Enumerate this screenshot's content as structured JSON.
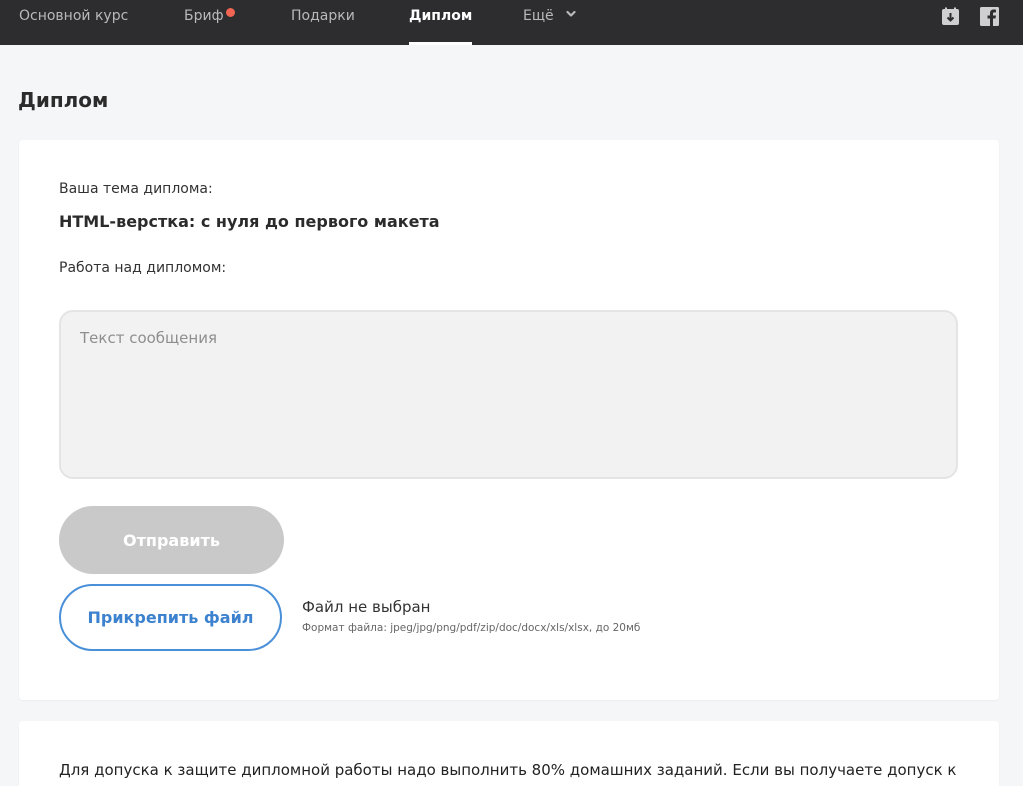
{
  "nav": {
    "items": [
      {
        "label": "Основной курс"
      },
      {
        "label": "Бриф"
      },
      {
        "label": "Подарки"
      },
      {
        "label": "Диплом"
      },
      {
        "label": "Ещё"
      }
    ]
  },
  "colors": {
    "topbar": "#2d2c2e",
    "notification_dot": "#f26552",
    "accent_blue": "#4a90d9",
    "disabled_button": "#c9c9c9"
  },
  "icons": [
    "calendar-download-icon",
    "facebook-icon",
    "chevron-down-icon"
  ],
  "page": {
    "title": "Диплом"
  },
  "diploma": {
    "topic_label": "Ваша тема диплома:",
    "topic": "HTML-верстка: с нуля до первого макета",
    "work_label": "Работа над дипломом:",
    "message_placeholder": "Текст сообщения",
    "send_label": "Отправить",
    "attach_label": "Прикрепить файл",
    "file_status": "Файл не выбран",
    "file_hint": "Формат файла: jpeg/jpg/png/pdf/zip/doc/docx/xls/xlsx, до 20мб"
  },
  "info": {
    "text": "Для допуска к защите дипломной работы надо выполнить 80% домашних заданий. Если вы получаете допуск к"
  }
}
